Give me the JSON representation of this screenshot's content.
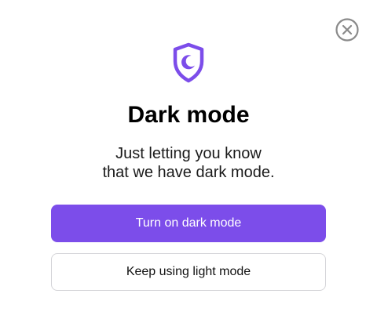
{
  "dialog": {
    "title": "Dark mode",
    "message_line1": "Just letting you know",
    "message_line2": "that we have dark mode.",
    "primary_button_label": "Turn on dark mode",
    "secondary_button_label": "Keep using light mode",
    "icon": "shield-moon-icon",
    "close_icon": "close-circle-icon"
  },
  "colors": {
    "accent": "#7c4dea",
    "close_icon": "#8a8a8a",
    "secondary_border": "#d4d4d8"
  }
}
